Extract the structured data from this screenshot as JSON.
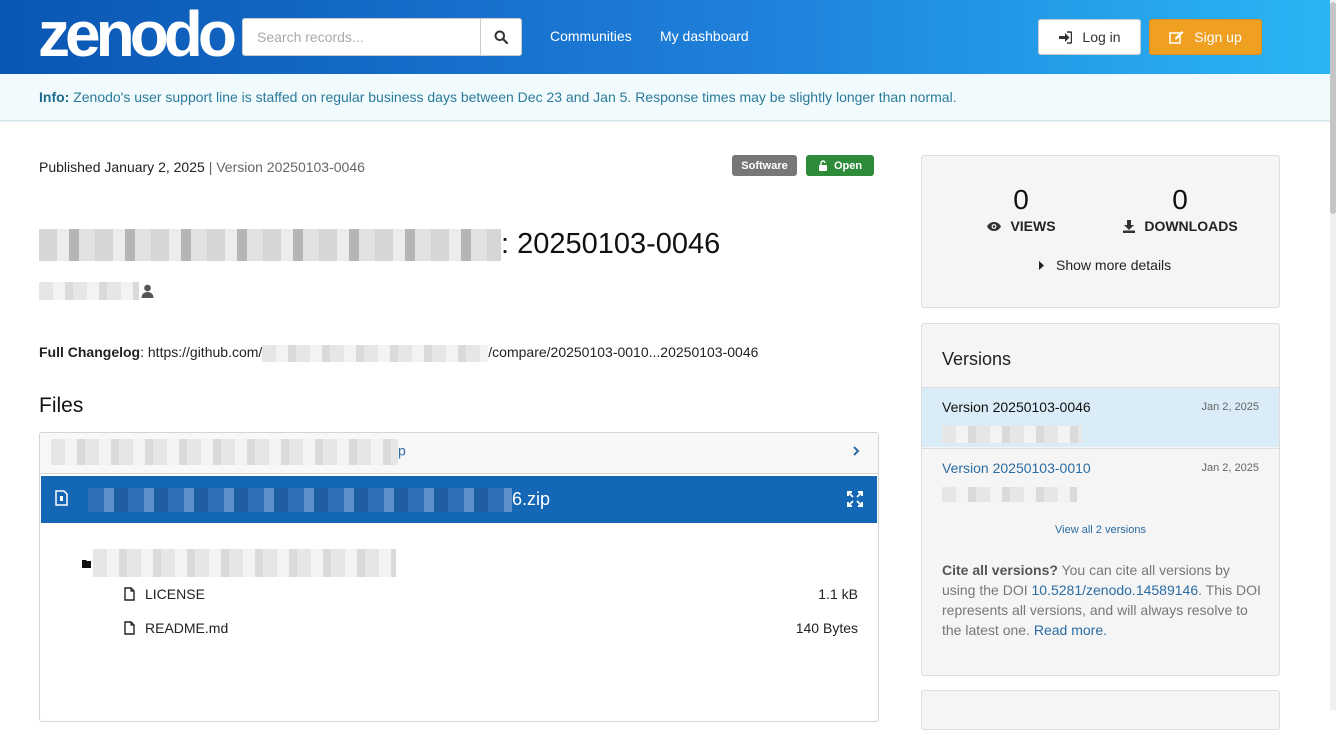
{
  "header": {
    "logo": "zenodo",
    "search_placeholder": "Search records...",
    "nav": [
      "Communities",
      "My dashboard"
    ],
    "login_label": "Log in",
    "signup_label": "Sign up"
  },
  "info_banner": {
    "label": "Info:",
    "text": "Zenodo's user support line is staffed on regular business days between Dec 23 and Jan 5. Response times may be slightly longer than normal."
  },
  "record": {
    "published": "Published January 2, 2025",
    "separator": "|",
    "version": "Version 20250103-0046",
    "badges": {
      "type": "Software",
      "access": "Open"
    },
    "title_suffix": ": 20250103-0046",
    "changelog_label": "Full Changelog",
    "changelog_prefix": ": https://github.com/",
    "changelog_suffix": "/compare/20250103-0010...20250103-0046"
  },
  "files": {
    "heading": "Files",
    "accordion_suffix": "p",
    "archive_suffix": "6.zip",
    "entries": [
      {
        "name": "LICENSE",
        "size": "1.1 kB"
      },
      {
        "name": "README.md",
        "size": "140 Bytes"
      }
    ]
  },
  "stats": {
    "views": "0",
    "views_label": "VIEWS",
    "downloads": "0",
    "downloads_label": "DOWNLOADS",
    "more_label": "Show more details"
  },
  "versions": {
    "heading": "Versions",
    "items": [
      {
        "name": "Version 20250103-0046",
        "date": "Jan 2, 2025"
      },
      {
        "name": "Version 20250103-0010",
        "date": "Jan 2, 2025"
      }
    ],
    "view_all": "View all 2 versions",
    "cite_bold": "Cite all versions?",
    "cite_text1": " You can cite all versions by using the DOI ",
    "cite_doi": "10.5281/zenodo.14589146",
    "cite_text2": ". This DOI represents all versions, and will always resolve to the latest one. ",
    "read_more": "Read more."
  },
  "colors": {
    "accent": "#1467b5",
    "signup": "#f0a020",
    "open_badge": "#2e8b3a",
    "info_bg": "#f1fbfd"
  }
}
